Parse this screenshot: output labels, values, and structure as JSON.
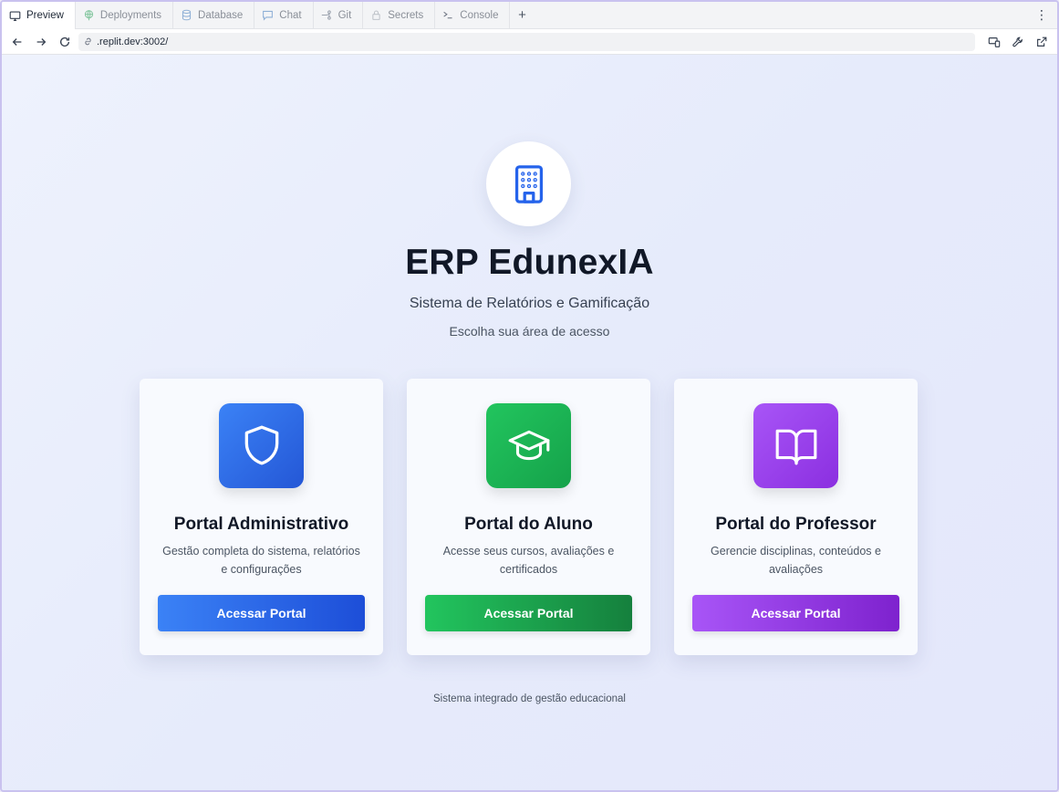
{
  "tabs": [
    {
      "label": "Preview",
      "icon": "monitor-icon",
      "active": true
    },
    {
      "label": "Deployments",
      "icon": "globe-icon",
      "active": false
    },
    {
      "label": "Database",
      "icon": "database-icon",
      "active": false
    },
    {
      "label": "Chat",
      "icon": "chat-icon",
      "active": false
    },
    {
      "label": "Git",
      "icon": "git-icon",
      "active": false
    },
    {
      "label": "Secrets",
      "icon": "lock-icon",
      "active": false
    },
    {
      "label": "Console",
      "icon": "terminal-icon",
      "active": false
    }
  ],
  "tab_add_label": "+",
  "tab_menu_label": "⋮",
  "url": ".replit.dev:3002/",
  "hero": {
    "icon": "building-icon",
    "title": "ERP EdunexIA",
    "subtitle": "Sistema de Relatórios e Gamificação",
    "prompt": "Escolha sua área de acesso"
  },
  "portals": [
    {
      "icon": "shield-icon",
      "title": "Portal Administrativo",
      "description": "Gestão completa do sistema, relatórios e configurações",
      "button": "Acessar Portal",
      "accent": "#3b82f6"
    },
    {
      "icon": "graduation-cap-icon",
      "title": "Portal do Aluno",
      "description": "Acesse seus cursos, avaliações e certificados",
      "button": "Acessar Portal",
      "accent": "#22c55e"
    },
    {
      "icon": "book-open-icon",
      "title": "Portal do Professor",
      "description": "Gerencie disciplinas, conteúdos e avaliações",
      "button": "Acessar Portal",
      "accent": "#a855f7"
    }
  ],
  "footer": "Sistema integrado de gestão educacional"
}
